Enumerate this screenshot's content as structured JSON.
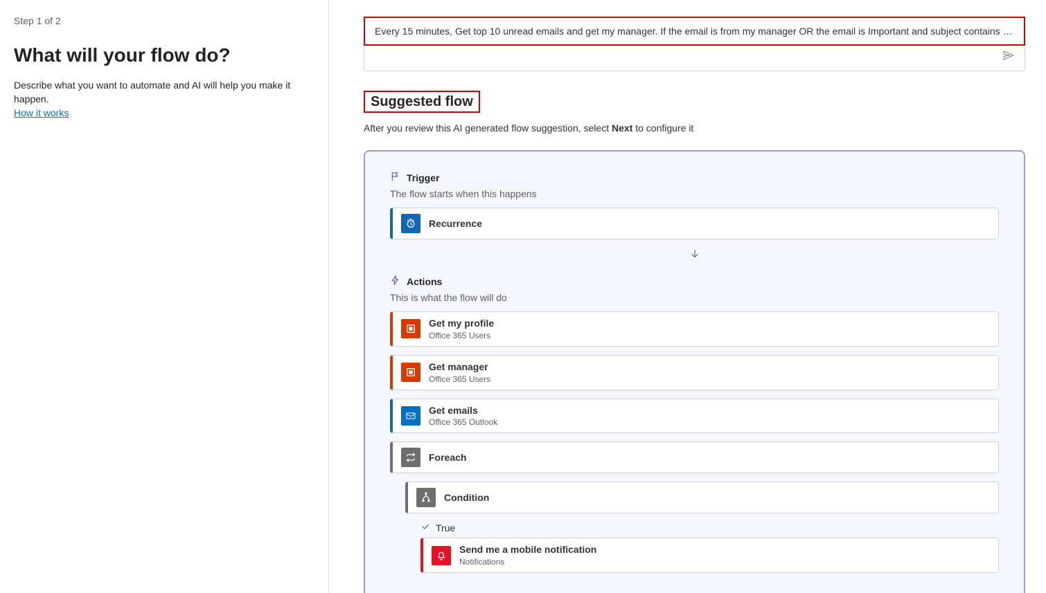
{
  "left": {
    "step": "Step 1 of 2",
    "heading": "What will your flow do?",
    "subtext": "Describe what you want to automate and AI will help you make it happen.",
    "link": "How it works"
  },
  "prompt": {
    "text": "Every 15 minutes, Get top 10 unread emails and get my manager. If the email is from my manager OR the email is Important and subject contains 'mee..."
  },
  "suggested": {
    "title": "Suggested flow",
    "sub_pre": "After you review this AI generated flow suggestion, select ",
    "sub_bold": "Next",
    "sub_post": " to configure it"
  },
  "trigger": {
    "label": "Trigger",
    "desc": "The flow starts when this happens",
    "card": {
      "title": "Recurrence"
    }
  },
  "actions": {
    "label": "Actions",
    "desc": "This is what the flow will do",
    "profile": {
      "title": "Get my profile",
      "sub": "Office 365 Users"
    },
    "manager": {
      "title": "Get manager",
      "sub": "Office 365 Users"
    },
    "emails": {
      "title": "Get emails",
      "sub": "Office 365 Outlook"
    },
    "foreach": {
      "title": "Foreach"
    },
    "condition": {
      "title": "Condition"
    },
    "branchTrue": "True",
    "notify": {
      "title": "Send me a mobile notification",
      "sub": "Notifications"
    }
  }
}
